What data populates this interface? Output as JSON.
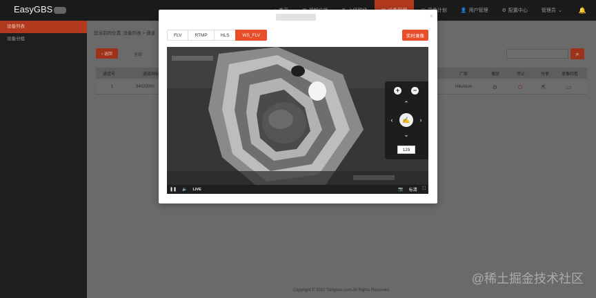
{
  "app": {
    "name": "EasyGBS"
  },
  "topnav": {
    "items": [
      {
        "label": "首页"
      },
      {
        "label": "视频广场"
      },
      {
        "label": "上级联级"
      },
      {
        "label": "设备管理",
        "active": true
      },
      {
        "label": "录像计划"
      },
      {
        "label": "用户管理"
      },
      {
        "label": "配置中心"
      },
      {
        "label": "管理员"
      }
    ]
  },
  "sidebar": {
    "items": [
      {
        "label": "设备列表",
        "active": true
      },
      {
        "label": "设备分组"
      }
    ]
  },
  "main": {
    "breadcrumb": "您当前的位置: 设备列表 > 通道",
    "back_label": "‹ 返回",
    "filter_label": "全部",
    "table": {
      "headers": [
        "通道号",
        "通道国标",
        "厂家",
        "播放",
        "停止",
        "分享",
        "录像回看"
      ],
      "row": {
        "index": "1",
        "channel_id": "34020000",
        "vendor": "Hikvision"
      }
    },
    "footer": "Copyright © 2022 Tsingsee.com All Rights Reserved.",
    "watermark": "@稀土掘金技术社区"
  },
  "modal": {
    "title": "",
    "close": "×",
    "tabs": [
      {
        "label": "FLV",
        "active": false
      },
      {
        "label": "RTMP",
        "active": false
      },
      {
        "label": "HLS",
        "active": false
      },
      {
        "label": "WS_FLV",
        "active": true
      }
    ],
    "record_label": "实时录像",
    "player": {
      "ptz_speed": "129",
      "live_label": "LIVE",
      "quality_label": "标清"
    }
  },
  "colors": {
    "accent": "#e84e2a",
    "dark": "#1b1b1b"
  }
}
